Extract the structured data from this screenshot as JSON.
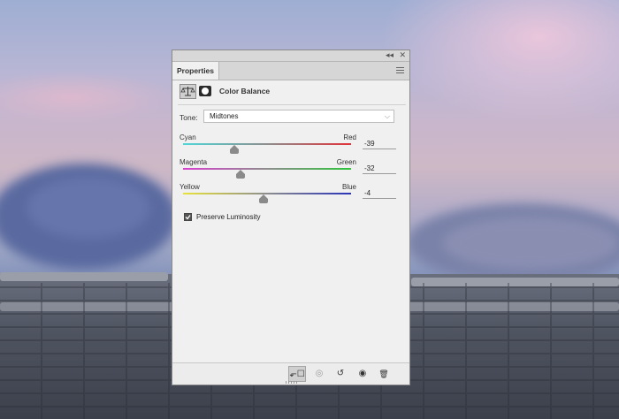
{
  "window": {
    "collapse_icon": "double-chevron-icon",
    "close_icon": "close-icon",
    "collapse_glyph": "◂◂",
    "close_glyph": "✕"
  },
  "tabs": [
    {
      "label": "Properties",
      "active": true
    }
  ],
  "panel_menu_icon": "hamburger-menu-icon",
  "header": {
    "adjustment_icon": "balance-scale-icon",
    "mask_icon": "layer-mask-icon",
    "title": "Color Balance"
  },
  "tone": {
    "label": "Tone:",
    "value": "Midtones"
  },
  "sliders": [
    {
      "left": "Cyan",
      "right": "Red",
      "value": "-39",
      "min": -100,
      "max": 100,
      "level": -39,
      "track_from": "#4fd6d8",
      "track_to": "#e0333a"
    },
    {
      "left": "Magenta",
      "right": "Green",
      "value": "-32",
      "min": -100,
      "max": 100,
      "level": -32,
      "track_from": "#d83fd0",
      "track_to": "#2ec43a"
    },
    {
      "left": "Yellow",
      "right": "Blue",
      "value": "-4",
      "min": -100,
      "max": 100,
      "level": -4,
      "track_from": "#e8e23a",
      "track_to": "#2a34b8"
    }
  ],
  "preserve_luminosity": {
    "label": "Preserve Luminosity",
    "checked": true
  },
  "bottom_buttons": [
    {
      "name": "clip-to-layer-icon",
      "glyph": "⬐☐",
      "active": true
    },
    {
      "name": "view-previous-state-icon",
      "glyph": "◎",
      "active": false
    },
    {
      "name": "reset-icon",
      "glyph": "↺",
      "active": false
    },
    {
      "name": "visibility-eye-icon",
      "glyph": "◉",
      "active": false
    },
    {
      "name": "trash-icon",
      "glyph": "🗑",
      "active": false
    }
  ]
}
